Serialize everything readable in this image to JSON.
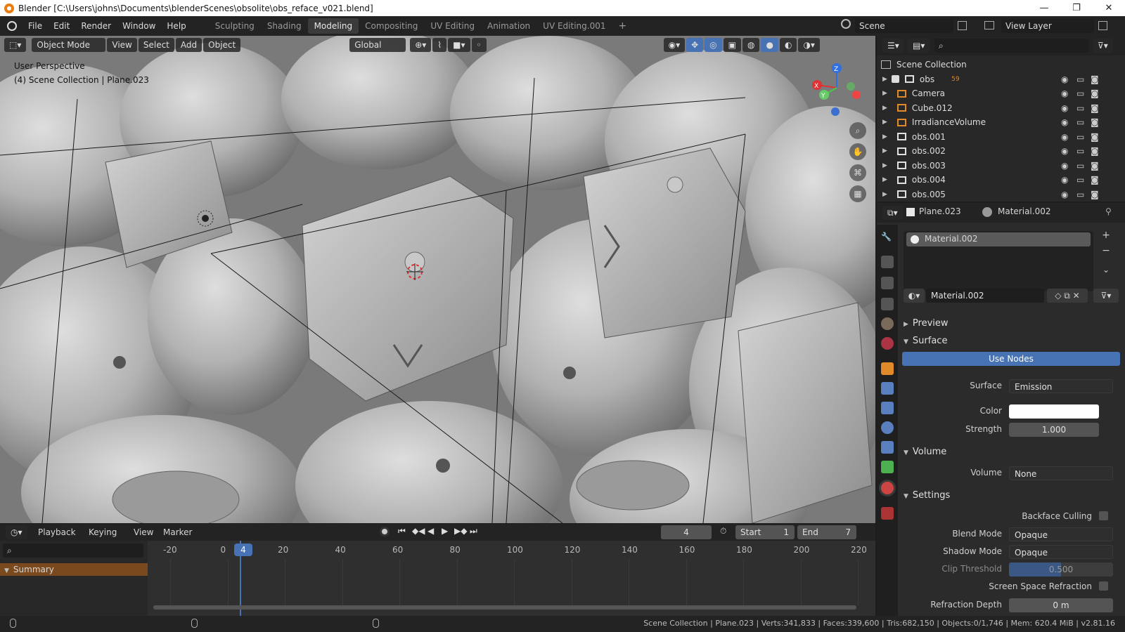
{
  "window": {
    "title": "Blender [C:\\Users\\johns\\Documents\\blenderScenes\\obsolite\\obs_reface_v021.blend]",
    "minimize": "—",
    "maximize": "❐",
    "close": "✕"
  },
  "menu": [
    "File",
    "Edit",
    "Render",
    "Window",
    "Help"
  ],
  "workspaces": [
    {
      "label": "Sculpting",
      "active": false
    },
    {
      "label": "Shading",
      "active": false
    },
    {
      "label": "Modeling",
      "active": true
    },
    {
      "label": "Compositing",
      "active": false
    },
    {
      "label": "UV Editing",
      "active": false
    },
    {
      "label": "Animation",
      "active": false
    },
    {
      "label": "UV Editing.001",
      "active": false
    }
  ],
  "add_workspace": "+",
  "scene": "Scene",
  "view_layer": "View Layer",
  "viewport": {
    "mode": "Object Mode",
    "menus": [
      "View",
      "Select",
      "Add",
      "Object"
    ],
    "orientation": "Global",
    "overlay_text_1": "User Perspective",
    "overlay_text_2": "(4) Scene Collection | Plane.023",
    "gizmo": {
      "x": "X",
      "y": "Y",
      "z": "Z"
    }
  },
  "outliner": {
    "root": "Scene Collection",
    "items": [
      {
        "name": "obs",
        "icon": "collection-icon",
        "extra": "59"
      },
      {
        "name": "Camera",
        "icon": "camera-icon",
        "extra": ""
      },
      {
        "name": "Cube.012",
        "icon": "mesh-icon",
        "extra": ""
      },
      {
        "name": "IrradianceVolume",
        "icon": "probe-icon",
        "extra": ""
      },
      {
        "name": "obs.001",
        "icon": "collection-icon",
        "extra": ""
      },
      {
        "name": "obs.002",
        "icon": "collection-icon",
        "extra": ""
      },
      {
        "name": "obs.003",
        "icon": "collection-icon",
        "extra": ""
      },
      {
        "name": "obs.004",
        "icon": "collection-icon",
        "extra": ""
      },
      {
        "name": "obs.005",
        "icon": "collection-icon",
        "extra": ""
      }
    ]
  },
  "properties": {
    "object": "Plane.023",
    "material": "Material.002",
    "slot": "Material.002",
    "datablock": "Material.002",
    "panels": {
      "preview": "Preview",
      "surface": "Surface",
      "use_nodes": "Use Nodes",
      "surface_label": "Surface",
      "surface_value": "Emission",
      "color_label": "Color",
      "strength_label": "Strength",
      "strength_value": "1.000",
      "volume": "Volume",
      "volume_label": "Volume",
      "volume_value": "None",
      "settings": "Settings",
      "backface": "Backface Culling",
      "blend_label": "Blend Mode",
      "blend_value": "Opaque",
      "shadow_label": "Shadow Mode",
      "shadow_value": "Opaque",
      "clip_label": "Clip Threshold",
      "clip_value": "0.500",
      "ssr": "Screen Space Refraction",
      "refr_label": "Refraction Depth",
      "refr_value": "0 m"
    }
  },
  "timeline": {
    "menus": [
      "Playback",
      "Keying",
      "View",
      "Marker"
    ],
    "current_frame": "4",
    "start_label": "Start",
    "start": "1",
    "end_label": "End",
    "end": "7",
    "ticks": [
      "-20",
      "0",
      "20",
      "40",
      "60",
      "80",
      "100",
      "120",
      "140",
      "160",
      "180",
      "200",
      "220"
    ],
    "summary": "Summary"
  },
  "status": "Scene Collection | Plane.023 | Verts:341,833 | Faces:339,600 | Tris:682,150 | Objects:0/1,746 | Mem: 620.4 MiB | v2.81.16",
  "colors": {
    "accent": "#4772b3",
    "selection": "#e87d0d",
    "playhead": "#4772b3"
  }
}
